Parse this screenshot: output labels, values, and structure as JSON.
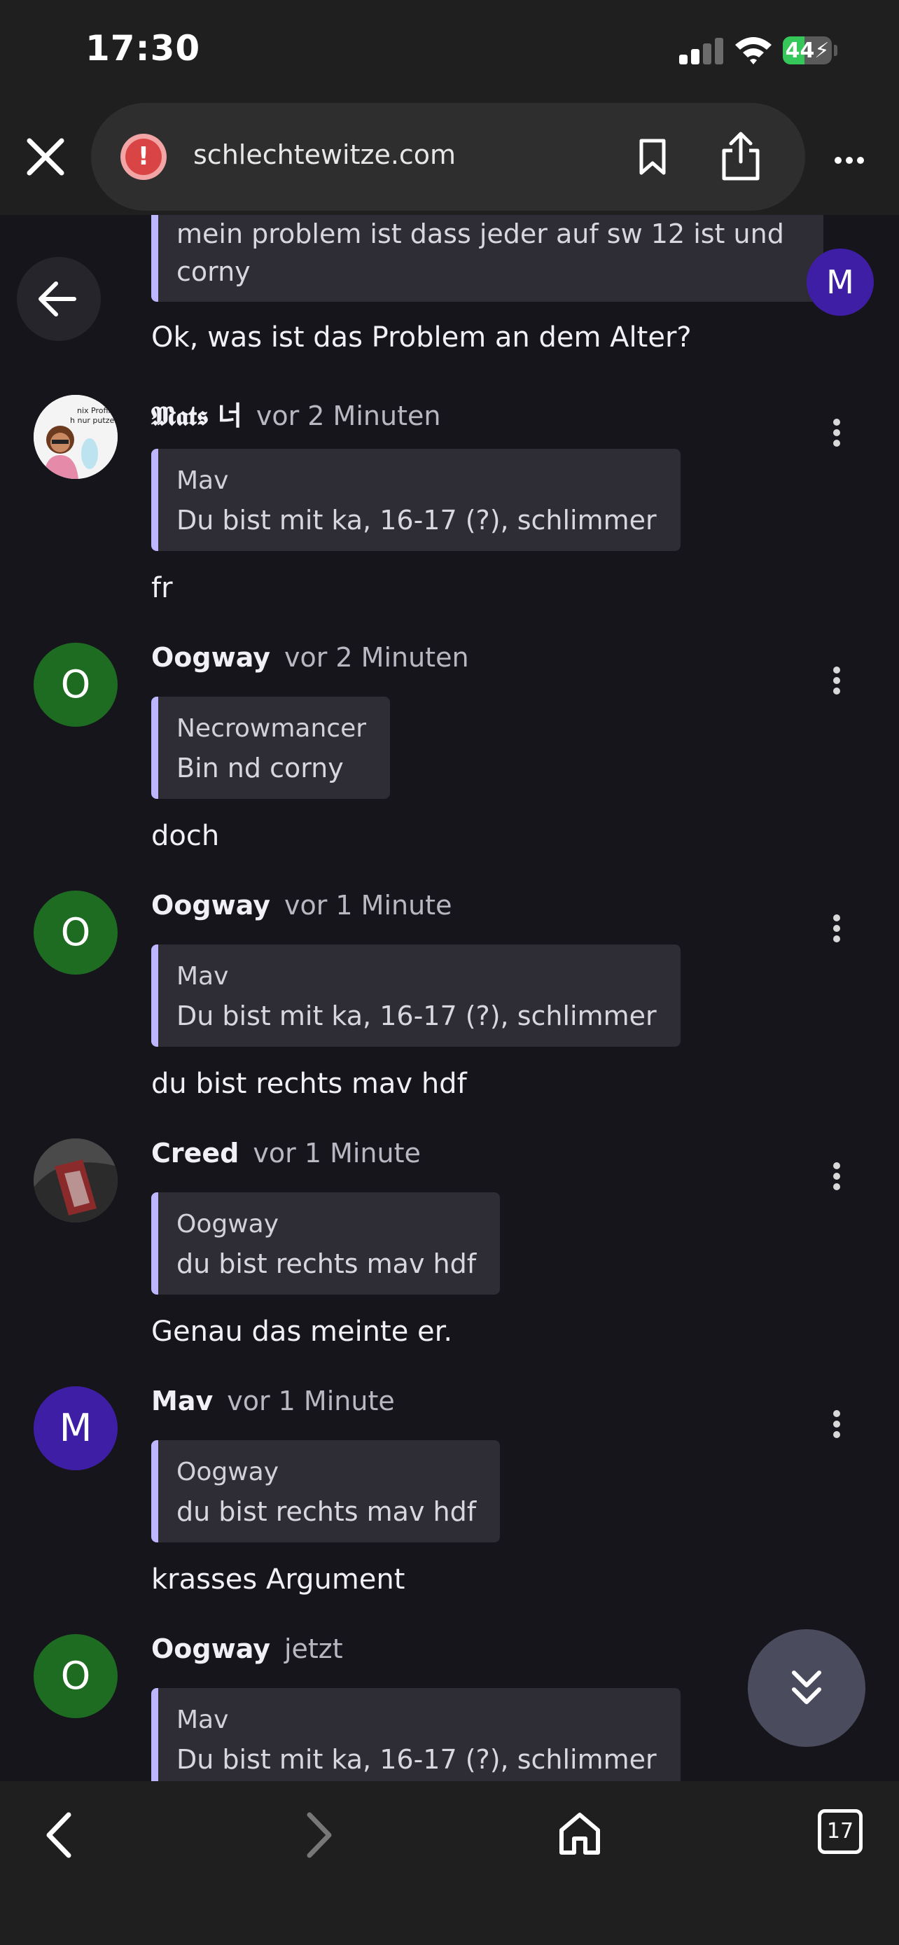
{
  "status_bar": {
    "time": "17:30",
    "battery": "44",
    "battery_level": 0.44
  },
  "browser": {
    "url": "schlechtewitze.com"
  },
  "top_partial": {
    "quote_text": "mein problem ist dass jeder auf sw 12 ist und corny",
    "text": "Ok, was ist das Problem an dem Alter?",
    "floating_avatar_letter": "M"
  },
  "messages": [
    {
      "author": "𝕸𝖆𝖙𝖘 너",
      "time": "vor 2 Minuten",
      "avatar": "image",
      "quote_author": "Mav",
      "quote_text": "Du bist mit ka, 16-17 (?), schlimmer",
      "text": "fr"
    },
    {
      "author": "Oogway",
      "time": "vor 2 Minuten",
      "avatar": "O",
      "quote_author": "Necrowmancer",
      "quote_text": "Bin nd corny",
      "text": "doch"
    },
    {
      "author": "Oogway",
      "time": "vor 1 Minute",
      "avatar": "O",
      "quote_author": "Mav",
      "quote_text": "Du bist mit ka, 16-17 (?), schlimmer",
      "text": "du bist rechts mav hdf"
    },
    {
      "author": "Creed",
      "time": "vor 1 Minute",
      "avatar": "image",
      "quote_author": "Oogway",
      "quote_text": "du bist rechts mav hdf",
      "text": "Genau das meinte er."
    },
    {
      "author": "Mav",
      "time": "vor 1 Minute",
      "avatar": "M",
      "quote_author": "Oogway",
      "quote_text": "du bist rechts mav hdf",
      "text": "krasses Argument"
    },
    {
      "author": "Oogway",
      "time": "jetzt",
      "avatar": "O",
      "quote_author": "Mav",
      "quote_text": "Du bist mit ka, 16-17 (?), schlimmer",
      "text": ""
    }
  ],
  "avatar_image_text": [
    "nix Profilbild",
    "h nur putzen hier"
  ],
  "toolbar": {
    "tab_count": "17"
  },
  "colors": {
    "quote_bar": "#bcb7ff",
    "avatar_green": "#1e6b22",
    "avatar_indigo": "#3f1ea6",
    "background": "#16151b"
  },
  "icons": [
    "close-icon",
    "warning-icon",
    "bookmark-icon",
    "share-icon",
    "more-icon",
    "back-arrow-icon",
    "kebab-menu-icon",
    "double-chevron-down-icon",
    "chevron-left-icon",
    "chevron-right-icon",
    "home-icon",
    "tabs-icon"
  ]
}
